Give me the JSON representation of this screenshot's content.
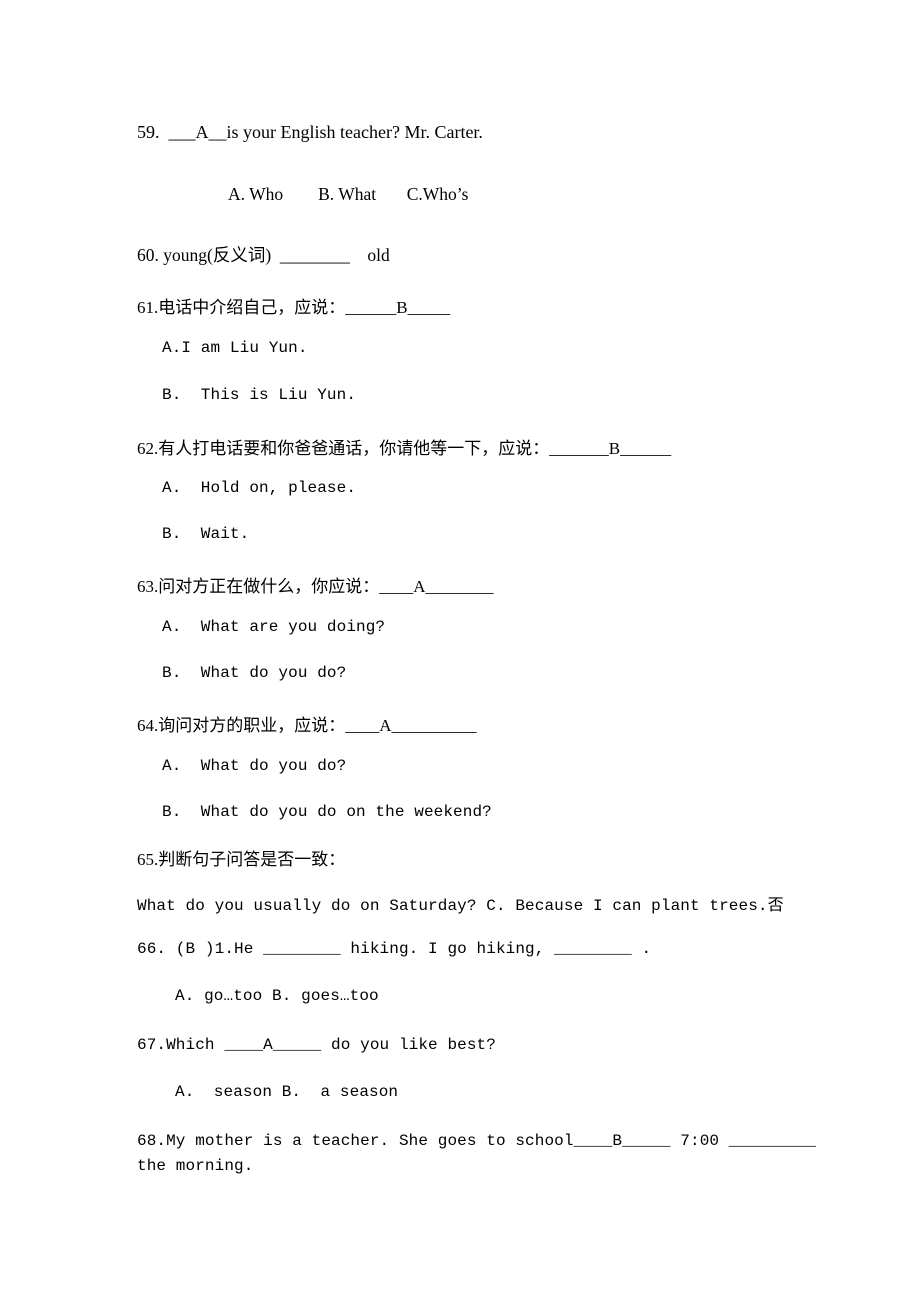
{
  "document": {
    "background_color": "#ffffff",
    "text_color": "#000000"
  },
  "items": [
    {
      "id": "q59",
      "number": "59.",
      "stem": "59.  ___A__is your English teacher? Mr. Carter.",
      "options_line": "A. Who        B. What       C.Who’s"
    },
    {
      "id": "q60",
      "number": "60.",
      "stem": "60. young(反义词)  ________    old"
    },
    {
      "id": "q61",
      "number": "61.",
      "stem": "61.电话中介绍自己，应说：______B_____",
      "option_a": "A.I am Liu Yun.",
      "option_b": "B.  This is Liu Yun."
    },
    {
      "id": "q62",
      "number": "62.",
      "stem": "62.有人打电话要和你爸爸通话，你请他等一下，应说：_______B______",
      "option_a": "A.  Hold on, please.",
      "option_b": "B.  Wait."
    },
    {
      "id": "q63",
      "number": "63.",
      "stem": "63.问对方正在做什么，你应说：____A________",
      "option_a": "A.  What are you doing?",
      "option_b": "B.  What do you do?"
    },
    {
      "id": "q64",
      "number": "64.",
      "stem": "64.询问对方的职业，应说：____A__________",
      "option_a": "A.  What do you do?",
      "option_b": "B.  What do you do on the weekend?"
    },
    {
      "id": "q65",
      "number": "65.",
      "stem": "65.判断句子问答是否一致：",
      "body": "What do you usually do on Saturday? C. Because I can plant trees.否"
    },
    {
      "id": "q66",
      "number": "66.",
      "stem": "66. (B )1.He ________ hiking. I go hiking, ________ .",
      "options_line": "A. go…too B. goes…too"
    },
    {
      "id": "q67",
      "number": "67.",
      "stem": "67.Which ____A_____ do you like best?",
      "options_line": "A.  season B.  a season"
    },
    {
      "id": "q68",
      "number": "68.",
      "stem": "68.My mother is a teacher. She goes to school____B_____ 7:00 _________",
      "stem_line2": "the morning."
    }
  ]
}
